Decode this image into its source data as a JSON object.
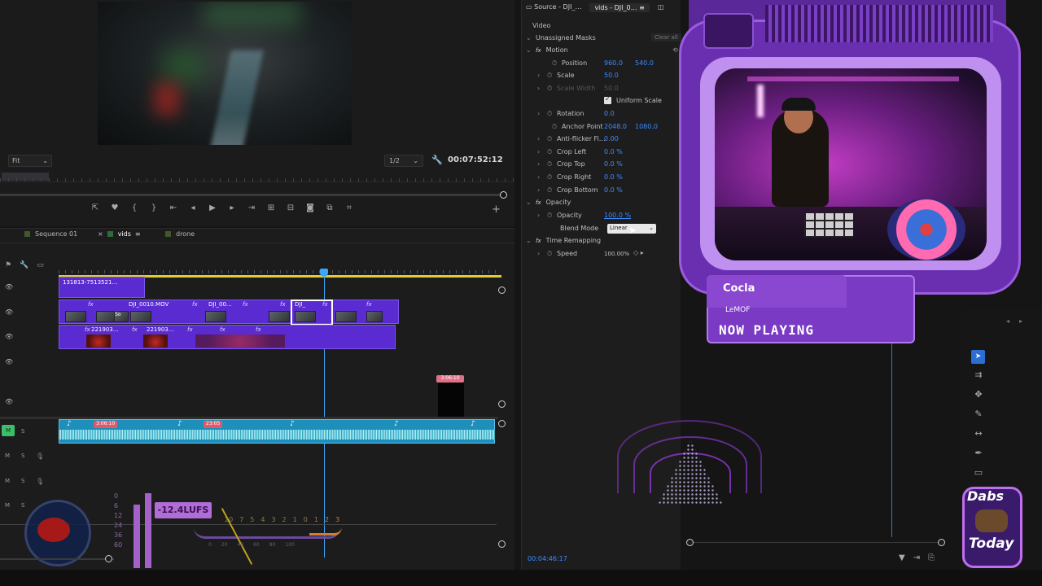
{
  "monitor": {
    "fit": "Fit",
    "resolution": "1/2",
    "timecode": "00:07:52:12"
  },
  "timeline": {
    "tabs": [
      "Sequence 01",
      "vids",
      "drone"
    ],
    "tab_colors": [
      "#3f5a2a",
      "#2f6a3a",
      "#3f5a2a"
    ],
    "v3_clip": "131813-7513521…",
    "v2_clips": [
      "DJI_0010.MOV",
      "So",
      "DJI_00…",
      "DJI_"
    ],
    "v1_clips": [
      "221903…",
      "221903…"
    ],
    "black_tag": "3:06:10",
    "audio_tags": [
      "3:06:10",
      "23:05"
    ],
    "track_labels": [
      "M",
      "S",
      "M",
      "S",
      "M",
      "S",
      "M",
      "S"
    ],
    "lufs": "-12.4LUFS",
    "lufs_scale": [
      "0",
      "6",
      "12",
      "24",
      "36",
      "60"
    ],
    "lufs_dial": [
      "20",
      "7",
      "5",
      "4",
      "3",
      "2",
      "1",
      "0",
      "1",
      "2",
      "3"
    ],
    "lufs_dial_scale": [
      "0",
      "20",
      "40",
      "60",
      "80",
      "100"
    ]
  },
  "effects": {
    "tabs": [
      "Source - DJI_…",
      "vids - DJI_0…"
    ],
    "section": "Video",
    "masks": "Unassigned Masks",
    "clear_all": "Clear all",
    "motion": "Motion",
    "position_label": "Position",
    "position_x": "960.0",
    "position_y": "540.0",
    "scale_label": "Scale",
    "scale_val": "50.0",
    "scale_width_label": "Scale Width",
    "scale_width_val": "50.0",
    "uniform_scale": "Uniform Scale",
    "rotation_label": "Rotation",
    "rotation_val": "0.0",
    "anchor_label": "Anchor Point",
    "anchor_x": "2048.0",
    "anchor_y": "1080.0",
    "antiflicker_label": "Anti-flicker Fi…",
    "antiflicker_val": "0.00",
    "crop_left_label": "Crop Left",
    "crop_left_val": "0.0 %",
    "crop_top_label": "Crop Top",
    "crop_top_val": "0.0 %",
    "crop_right_label": "Crop Right",
    "crop_right_val": "0.0 %",
    "crop_bottom_label": "Crop Bottom",
    "crop_bottom_val": "0.0 %",
    "opacity_section": "Opacity",
    "opacity_label": "Opacity",
    "opacity_val": "100.0 %",
    "blend_label": "Blend Mode",
    "blend_val": "Linear",
    "time_remap": "Time Remapping",
    "speed_label": "Speed",
    "speed_val": "100.00%",
    "timecode": "00:04:46:17"
  },
  "overlay": {
    "artist": "Cocla",
    "title": "LeMOF",
    "label": "NOW PLAYING",
    "logo_top": "Dabs",
    "logo_bottom": "Today"
  },
  "colors": {
    "accent_blue": "#3d8bff",
    "clip_purple": "#5a2bd1",
    "audio_blue": "#1e8fba",
    "tv_purple": "#6a2fb0"
  }
}
